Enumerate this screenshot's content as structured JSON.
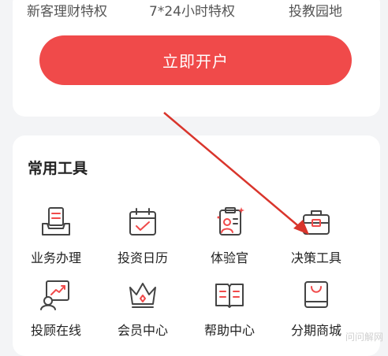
{
  "privileges": [
    "新客理财特权",
    "7*24小时特权",
    "投教园地"
  ],
  "open_account_label": "立即开户",
  "tools_title": "常用工具",
  "tools": [
    {
      "label": "业务办理",
      "icon": "tray-document-icon"
    },
    {
      "label": "投资日历",
      "icon": "calendar-icon"
    },
    {
      "label": "体验官",
      "icon": "clipboard-person-icon"
    },
    {
      "label": "决策工具",
      "icon": "toolbox-icon"
    },
    {
      "label": "投顾在线",
      "icon": "advisor-chart-icon"
    },
    {
      "label": "会员中心",
      "icon": "crown-icon"
    },
    {
      "label": "帮助中心",
      "icon": "open-book-icon"
    },
    {
      "label": "分期商城",
      "icon": "shopping-bag-icon"
    }
  ],
  "watermark": "问问解网",
  "colors": {
    "accent": "#f04a4a",
    "icon_stroke": "#444444",
    "annotation_arrow": "#d9352c"
  }
}
